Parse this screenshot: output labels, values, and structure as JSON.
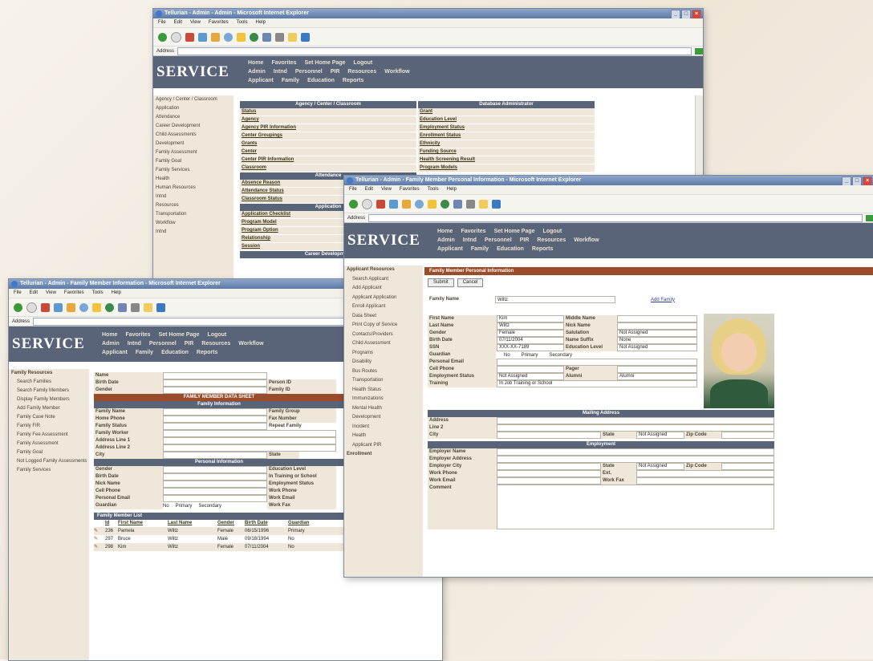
{
  "win1": {
    "title": "Tellurian - Admin - Admin - Microsoft Internet Explorer",
    "menus": [
      "File",
      "Edit",
      "View",
      "Favorites",
      "Tools",
      "Help"
    ],
    "address_label": "Address",
    "logo": "SERVICE",
    "nav_rows": [
      [
        "Home",
        "Favorites",
        "Set Home Page",
        "Logout"
      ],
      [
        "Admin",
        "Intnd",
        "Personnel",
        "PIR",
        "Resources",
        "Workflow"
      ],
      [
        "Applicant",
        "Family",
        "Education",
        "Reports"
      ]
    ],
    "sidebar": [
      "Agency / Center / Classroom",
      "Application",
      "Attendance",
      "Career Development",
      "Child Assessments",
      "Development",
      "Family Assessment",
      "Family Goal",
      "Family Services",
      "Health",
      "Human Resources",
      "Intnd",
      "Resources",
      "Transportation",
      "Workflow",
      "Intnd"
    ],
    "left_header": "Agency / Center / Classroom",
    "right_header": "Database Administrator",
    "left_links": [
      "Status",
      "Agency",
      "Agency PIR Information",
      "Center Groupings",
      "Grants",
      "Center",
      "Center PIR Information",
      "Classroom"
    ],
    "right_links": [
      "Grant",
      "Education Level",
      "Employment Status",
      "Enrollment Status",
      "Ethnicity",
      "Funding Source",
      "Health Screening Result",
      "Program Models"
    ],
    "section2_header": "Attendance",
    "section2_links": [
      "Absence Reason",
      "Attendance Status",
      "Classroom Status"
    ],
    "section3_header": "Application",
    "section3_links": [
      "Application Checklist",
      "Program Model",
      "Program Option",
      "Relationship",
      "Session"
    ],
    "section4_header": "Career Development"
  },
  "win2": {
    "title": "Tellurian - Admin - Family Member Information - Microsoft Internet Explorer",
    "menus": [
      "File",
      "Edit",
      "View",
      "Favorites",
      "Tools",
      "Help"
    ],
    "address_label": "Address",
    "logo": "SERVICE",
    "nav_rows": [
      [
        "Home",
        "Favorites",
        "Set Home Page",
        "Logout"
      ],
      [
        "Admin",
        "Intnd",
        "Personnel",
        "PIR",
        "Resources",
        "Workflow"
      ],
      [
        "Applicant",
        "Family",
        "Education",
        "Reports"
      ]
    ],
    "sidebar_title": "Family Resources",
    "sidebar": [
      "Search Families",
      "Search Family Members",
      "Display Family Members",
      "Add Family Member",
      "Family Case Note",
      "Family FIR",
      "Family Fee Assessment",
      "Family Assessment",
      "Family Goal",
      "Not Logged Family Assessments",
      "Family Services"
    ],
    "top_labels": [
      "Name",
      "Birth Date",
      "Gender"
    ],
    "top_right_labels": [
      "Person ID",
      "Family ID"
    ],
    "rust_bar": "FAMILY MEMBER DATA SHEET",
    "family_info_header": "Family Information",
    "family_labels": [
      "Family Name",
      "Home Phone",
      "Family Status",
      "Family Worker",
      "Address Line 1",
      "Address Line 2",
      "City"
    ],
    "family_right_labels": [
      "Family Group",
      "Fax Number"
    ],
    "repeat_family": "Repeat Family",
    "state_label": "State",
    "personal_header": "Personal Information",
    "personal_labels": [
      "Gender",
      "Birth Date",
      "Nick Name",
      "Cell Phone",
      "Personal Email",
      "Guardian"
    ],
    "personal_right_labels": [
      "Education Level",
      "In Training or School",
      "Employment Status",
      "Work Phone",
      "Work Email",
      "Work Fax"
    ],
    "guardian_options": [
      "No",
      "Primary",
      "Secondary"
    ],
    "list_header": "Family Member List",
    "list_columns": [
      "Id",
      "First Name",
      "Last Name",
      "Gender",
      "Birth Date",
      "Guardian"
    ],
    "list_rows": [
      [
        "236",
        "Pamela",
        "Wiltz",
        "Female",
        "06/15/1996",
        "Primary"
      ],
      [
        "297",
        "Bruce",
        "Wiltz",
        "Male",
        "09/18/1994",
        "No"
      ],
      [
        "298",
        "Kim",
        "Wiltz",
        "Female",
        "07/11/2004",
        "No"
      ]
    ]
  },
  "win3": {
    "title": "Tellurian - Admin - Family Member Personal Information - Microsoft Internet Explorer",
    "menus": [
      "File",
      "Edit",
      "View",
      "Favorites",
      "Tools",
      "Help"
    ],
    "address_label": "Address",
    "logo": "SERVICE",
    "nav_rows": [
      [
        "Home",
        "Favorites",
        "Set Home Page",
        "Logout"
      ],
      [
        "Admin",
        "Intnd",
        "Personnel",
        "PIR",
        "Resources",
        "Workflow"
      ],
      [
        "Applicant",
        "Family",
        "Education",
        "Reports"
      ]
    ],
    "sidebar": [
      "Applicant Resources",
      "Search Applicant",
      "Add Applicant",
      "Applicant Application",
      "Enroll Applicant",
      "Data Sheet",
      "Print Copy of Service",
      "Contacts/Providers",
      "Child Assessment",
      "Programs",
      "Disability",
      "Bus Routes",
      "Transportation",
      "Health Status",
      "Immunizations",
      "Mental Health",
      "Development",
      "Incident",
      "Health",
      "Applicant PIR",
      "Enrollment"
    ],
    "rust_bar": "Family Member Personal Information",
    "submit": "Submit",
    "cancel": "Cancel",
    "family_name_label": "Family Name",
    "family_name_value": "Wiltz",
    "add_family": "Add Family",
    "left_labels": [
      "First Name",
      "Last Name",
      "Gender",
      "Birth Date",
      "SSN",
      "Guardian",
      "Personal Email",
      "Cell Phone",
      "Employment Status",
      "Training"
    ],
    "left_values": [
      "Kim",
      "Wiltz",
      "Female",
      "07/11/2004",
      "XXX-XX-7189",
      "",
      "",
      "",
      "Not Assigned",
      ""
    ],
    "right_labels": [
      "Middle Name",
      "Nick Name",
      "Salutation",
      "Name Suffix",
      "Education Level"
    ],
    "right_values": [
      "",
      "",
      "Not Assigned",
      "None",
      "Not Assigned"
    ],
    "guardian_options": [
      "No",
      "Primary",
      "Secondary"
    ],
    "pager_label": "Pager",
    "alumni_label": "Alumni",
    "alumni_value": "Alumni",
    "training_value": "In Job Training or School",
    "mailing_header": "Mailing Address",
    "mailing_labels": [
      "Address",
      "Line 2",
      "City"
    ],
    "state_label": "State",
    "state_value": "Not Assigned",
    "zip_label": "Zip Code",
    "employment_header": "Employment",
    "employment_labels": [
      "Employer Name",
      "Employer Address",
      "Employer City",
      "Work Phone",
      "Work Email",
      "Comment"
    ],
    "emp_state_label": "State",
    "emp_state_value": "Not Assigned",
    "emp_zip_label": "Zip Code",
    "ext_label": "Ext.",
    "work_fax_label": "Work Fax"
  }
}
